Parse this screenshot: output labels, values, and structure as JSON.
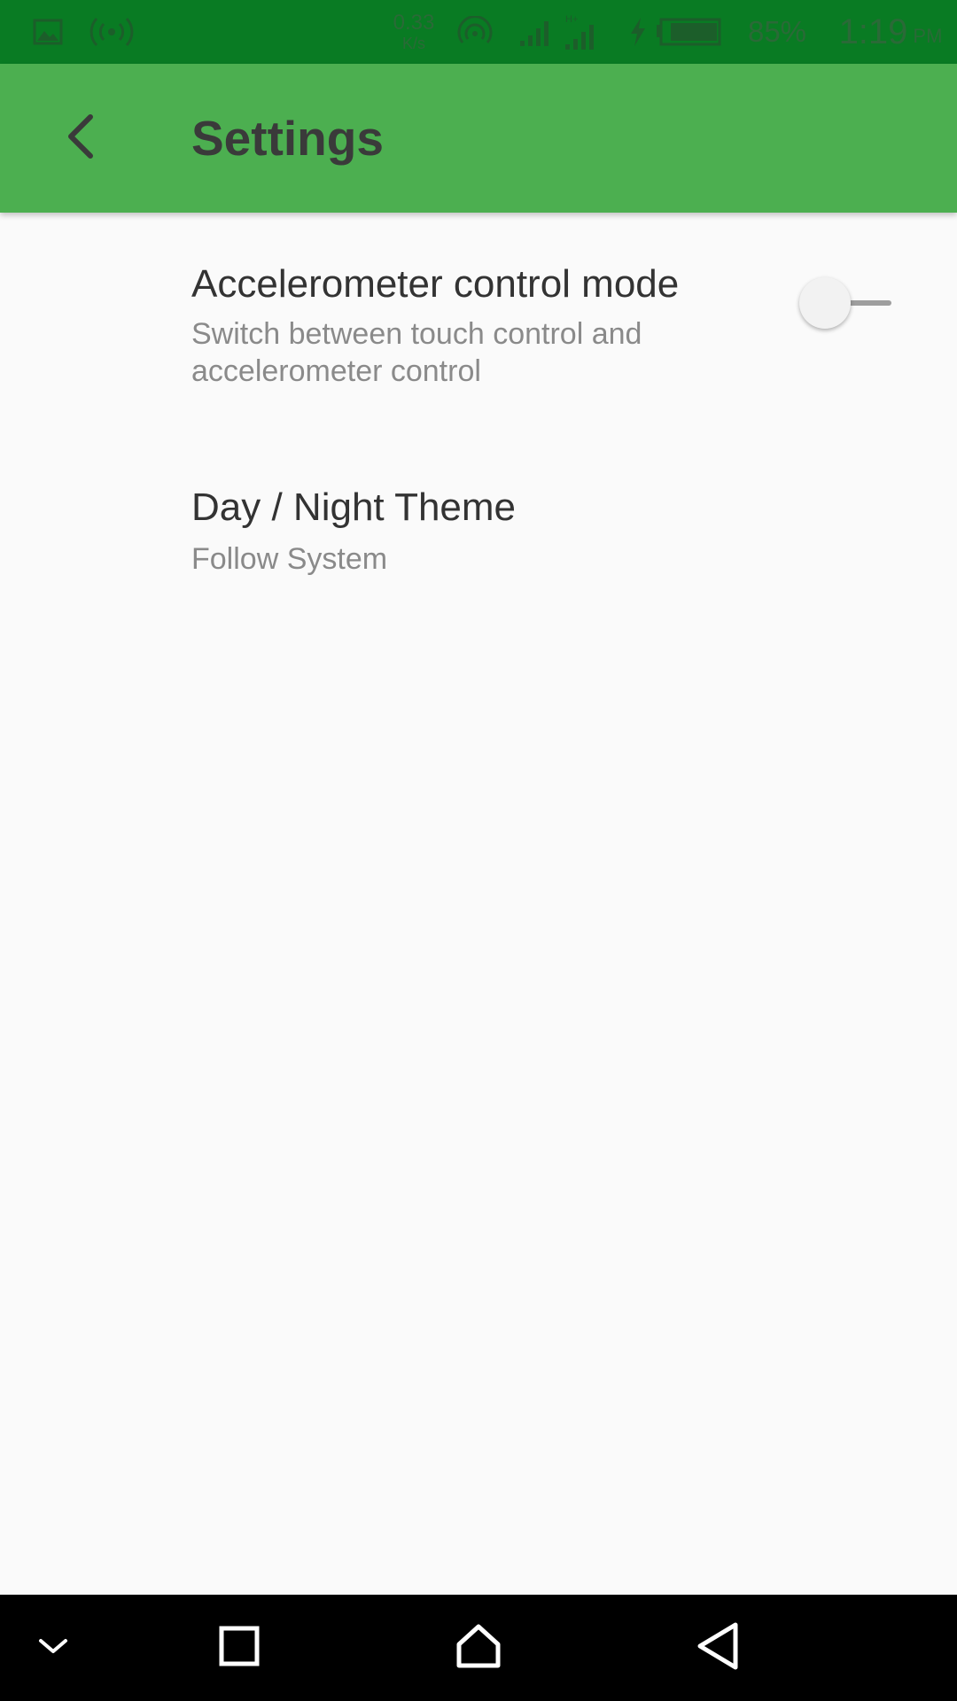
{
  "status_bar": {
    "net_speed_value": "0.33",
    "net_speed_unit": "K/s",
    "battery_percent": "85%",
    "time": "1:19",
    "time_suffix": "PM",
    "icons": [
      "gallery-notification-icon",
      "hotspot-icon",
      "wifi-icon",
      "cell-signal-1-icon",
      "cell-signal-2-icon",
      "charging-bolt-icon",
      "battery-icon"
    ]
  },
  "app_bar": {
    "title": "Settings",
    "back_icon": "chevron-left-icon",
    "background_color": "#4caf50"
  },
  "preferences": [
    {
      "title": "Accelerometer control mode",
      "summary": "Switch between touch control and accelerometer control",
      "toggle_on": false
    },
    {
      "title": "Day / Night Theme",
      "summary": "Follow System"
    }
  ],
  "nav_bar": {
    "icons": [
      "hide-nav-chevron-icon",
      "recents-square-icon",
      "home-icon",
      "back-triangle-icon"
    ]
  }
}
